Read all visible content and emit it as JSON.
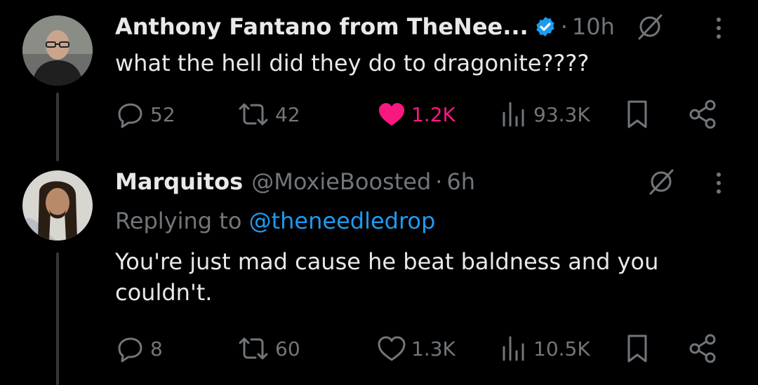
{
  "tweets": [
    {
      "display_name": "Anthony Fantano from TheNee...",
      "verified": true,
      "handle": "",
      "time": "10h",
      "text": "what the hell did they do to dragonite????",
      "avatar_icon": "avatar-man-glasses",
      "stats": {
        "replies": "52",
        "retweets": "42",
        "likes": "1.2K",
        "views": "93.3K"
      },
      "liked": true
    },
    {
      "display_name": "Marquitos",
      "verified": false,
      "handle": "@MoxieBoosted",
      "time": "6h",
      "replying_prefix": "Replying to",
      "replying_mention": "@theneedledrop",
      "text": "You're just mad cause he beat baldness and you couldn't.",
      "avatar_icon": "avatar-man-long-hair",
      "stats": {
        "replies": "8",
        "retweets": "60",
        "likes": "1.3K",
        "views": "10.5K"
      },
      "liked": false
    }
  ],
  "colors": {
    "background": "#000000",
    "text_primary": "#e7e9ea",
    "text_secondary": "#71767b",
    "accent_blue": "#1d9bf0",
    "like_pink": "#f91880",
    "thread_line": "#333639"
  },
  "separator_dot": "·"
}
